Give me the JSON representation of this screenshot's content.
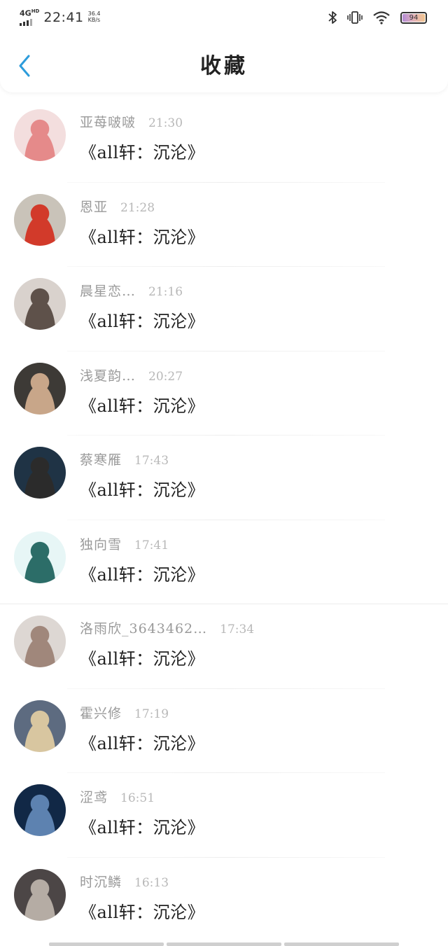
{
  "status_bar": {
    "network": "4G",
    "network_hd": "HD",
    "time": "22:41",
    "speed_value": "36.4",
    "speed_unit": "KB/s",
    "battery": "94"
  },
  "header": {
    "title": "收藏"
  },
  "items": [
    {
      "name": "亚苺啵啵",
      "time": "21:30",
      "content": "《all轩：沉沦》",
      "avatar_colors": [
        "#f3dede",
        "#e58a8a"
      ]
    },
    {
      "name": "恩亚",
      "time": "21:28",
      "content": "《all轩：沉沦》",
      "avatar_colors": [
        "#c9c3b9",
        "#d23a2a"
      ]
    },
    {
      "name": "晨星恋…",
      "time": "21:16",
      "content": "《all轩：沉沦》",
      "avatar_colors": [
        "#d9d2cd",
        "#5e514a"
      ]
    },
    {
      "name": "浅夏韵…",
      "time": "20:27",
      "content": "《all轩：沉沦》",
      "avatar_colors": [
        "#3d3a36",
        "#c8a689"
      ]
    },
    {
      "name": "蔡寒雁",
      "time": "17:43",
      "content": "《all轩：沉沦》",
      "avatar_colors": [
        "#1f3345",
        "#2b2b2b"
      ]
    },
    {
      "name": "独向雪",
      "time": "17:41",
      "content": "《all轩：沉沦》",
      "avatar_colors": [
        "#e7f6f6",
        "#2c6d68"
      ]
    },
    {
      "name": "洛雨欣_3643462…",
      "time": "17:34",
      "content": "《all轩：沉沦》",
      "avatar_colors": [
        "#ddd7d3",
        "#a0877b"
      ]
    },
    {
      "name": "霍兴修",
      "time": "17:19",
      "content": "《all轩：沉沦》",
      "avatar_colors": [
        "#5d6b80",
        "#d8c6a0"
      ]
    },
    {
      "name": "涩鸢",
      "time": "16:51",
      "content": "《all轩：沉沦》",
      "avatar_colors": [
        "#112846",
        "#5d82b0"
      ]
    },
    {
      "name": "时沉鳞",
      "time": "16:13",
      "content": "《all轩：沉沦》",
      "avatar_colors": [
        "#4c4646",
        "#b5aca4"
      ]
    }
  ]
}
